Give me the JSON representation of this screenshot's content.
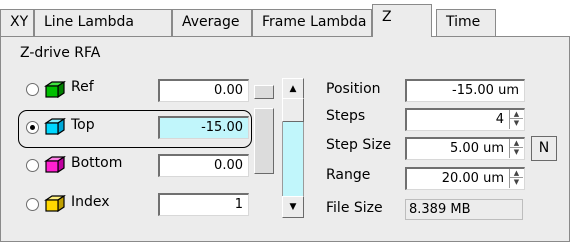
{
  "tabs": [
    {
      "label": "XY"
    },
    {
      "label": "Line Lambda"
    },
    {
      "label": "Average"
    },
    {
      "label": "Frame Lambda"
    },
    {
      "label": "Z"
    },
    {
      "label": "Time"
    }
  ],
  "section": {
    "title": "Z-drive RFA"
  },
  "positions": [
    {
      "label": "Ref",
      "value": "0.00",
      "selected": false,
      "icon": "green-cube-icon",
      "color": "#00c000"
    },
    {
      "label": "Top",
      "value": "-15.00",
      "selected": true,
      "icon": "cyan-cube-icon",
      "color": "#00d8ff"
    },
    {
      "label": "Bottom",
      "value": "0.00",
      "selected": false,
      "icon": "magenta-cube-icon",
      "color": "#ff20d0"
    },
    {
      "label": "Index",
      "value": "1",
      "selected": false,
      "icon": "yellow-cube-icon",
      "color": "#ffd800"
    }
  ],
  "params": {
    "position": {
      "label": "Position",
      "value": "-15.00 um"
    },
    "steps": {
      "label": "Steps",
      "value": "4"
    },
    "step_size": {
      "label": "Step Size",
      "value": "5.00 um"
    },
    "range": {
      "label": "Range",
      "value": "20.00 um"
    },
    "file_size": {
      "label": "File Size",
      "value": "8.389 MB"
    }
  },
  "n_button": {
    "label": "N"
  },
  "colors": {
    "highlight": "#c1f6fb",
    "panel": "#ececec"
  }
}
